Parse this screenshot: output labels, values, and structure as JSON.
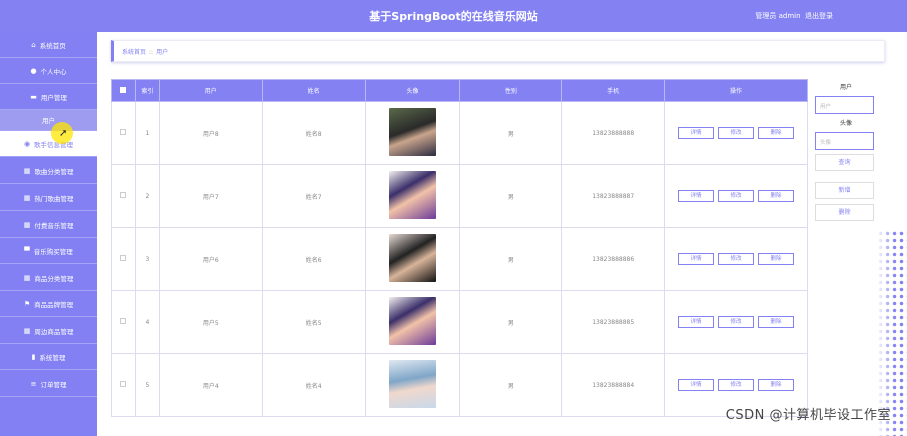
{
  "header": {
    "title": "基于SpringBoot的在线音乐网站",
    "user": "管理员 admin",
    "logout": "退出登录"
  },
  "sidebar": {
    "items": [
      {
        "label": "系统首页",
        "icon": "home-icon",
        "glyph": "⌂"
      },
      {
        "label": "个人中心",
        "icon": "person-icon",
        "glyph": "●"
      },
      {
        "label": "用户管理",
        "icon": "id-card-icon",
        "glyph": "▬"
      },
      {
        "label": "用户",
        "icon": "",
        "glyph": ""
      },
      {
        "label": "歌手信息管理",
        "icon": "location-icon",
        "glyph": "◉"
      },
      {
        "label": "歌曲分类管理",
        "icon": "grid-icon",
        "glyph": "▦"
      },
      {
        "label": "热门歌曲管理",
        "icon": "grid-icon",
        "glyph": "▦"
      },
      {
        "label": "付费音乐管理",
        "icon": "grid-icon",
        "glyph": "▦"
      },
      {
        "label": "音乐购买管理",
        "icon": "car-icon",
        "glyph": "▀"
      },
      {
        "label": "商品分类管理",
        "icon": "grid-icon",
        "glyph": "▦"
      },
      {
        "label": "商品品牌管理",
        "icon": "flag-icon",
        "glyph": "⚑"
      },
      {
        "label": "周边商品管理",
        "icon": "grid-icon",
        "glyph": "▦"
      },
      {
        "label": "系统管理",
        "icon": "bar-chart-icon",
        "glyph": "▮"
      },
      {
        "label": "订单管理",
        "icon": "list-icon",
        "glyph": "≡"
      }
    ]
  },
  "breadcrumb": {
    "home": "系统首页",
    "sep": "::",
    "current": "用户"
  },
  "table": {
    "headers": [
      "索引",
      "用户",
      "姓名",
      "头像",
      "性别",
      "手机",
      "操作"
    ],
    "rows": [
      {
        "index": "1",
        "user": "用户8",
        "name": "姓名8",
        "gender": "男",
        "phone": "13823888888"
      },
      {
        "index": "2",
        "user": "用户7",
        "name": "姓名7",
        "gender": "男",
        "phone": "13823888887"
      },
      {
        "index": "3",
        "user": "用户6",
        "name": "姓名6",
        "gender": "男",
        "phone": "13823888886"
      },
      {
        "index": "4",
        "user": "用户5",
        "name": "姓名5",
        "gender": "男",
        "phone": "13823888885"
      },
      {
        "index": "5",
        "user": "用户4",
        "name": "姓名4",
        "gender": "男",
        "phone": "13823888884"
      }
    ],
    "actions": {
      "detail": "详情",
      "edit": "修改",
      "delete": "删除"
    }
  },
  "search": {
    "user_label": "用户",
    "user_placeholder": "用户",
    "avatar_label": "头像",
    "avatar_placeholder": "头像",
    "query": "查询",
    "add": "新增",
    "delete": "删除"
  },
  "watermark": "CSDN @计算机毕设工作室",
  "colors": {
    "accent": "#8482f3",
    "sidebar": "#8280f2"
  }
}
